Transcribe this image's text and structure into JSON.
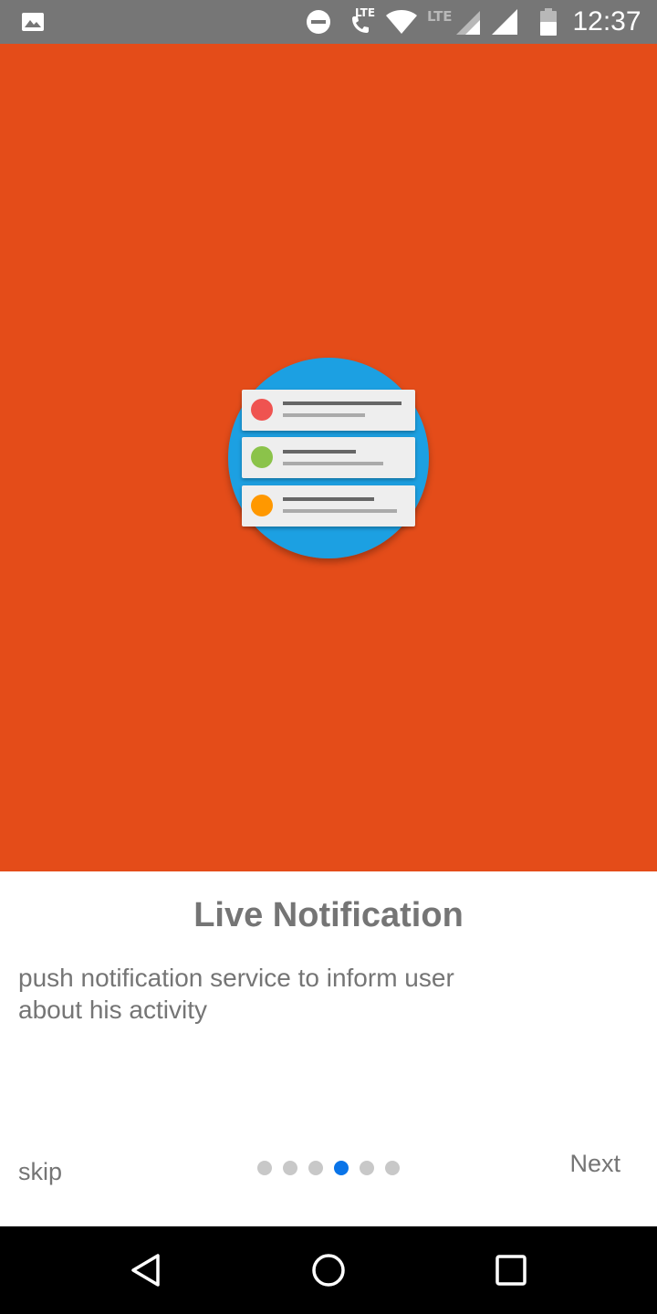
{
  "status_bar": {
    "time": "12:37",
    "lte_call_label": "LTE",
    "lte_signal_label": "LTE",
    "icons": [
      "image-icon",
      "do-not-disturb-icon",
      "volte-call-icon",
      "wifi-icon",
      "signal-icon",
      "signal-icon",
      "battery-icon"
    ]
  },
  "hero": {
    "background_color": "#e44c19",
    "illustration": {
      "icon": "notification-list-icon",
      "circle_color": "#1ea0e2",
      "item_dot_colors": [
        "#ef5350",
        "#8bc34a",
        "#ff9800"
      ]
    }
  },
  "slide": {
    "title": "Live Notification",
    "description": "push notification service to inform user about his activity"
  },
  "footer": {
    "skip_label": "skip",
    "next_label": "Next",
    "page_count": 6,
    "current_page": 4,
    "active_dot_color": "#0a74e8"
  },
  "nav_bar": {
    "icons": [
      "back-icon",
      "home-icon",
      "recents-icon"
    ]
  }
}
